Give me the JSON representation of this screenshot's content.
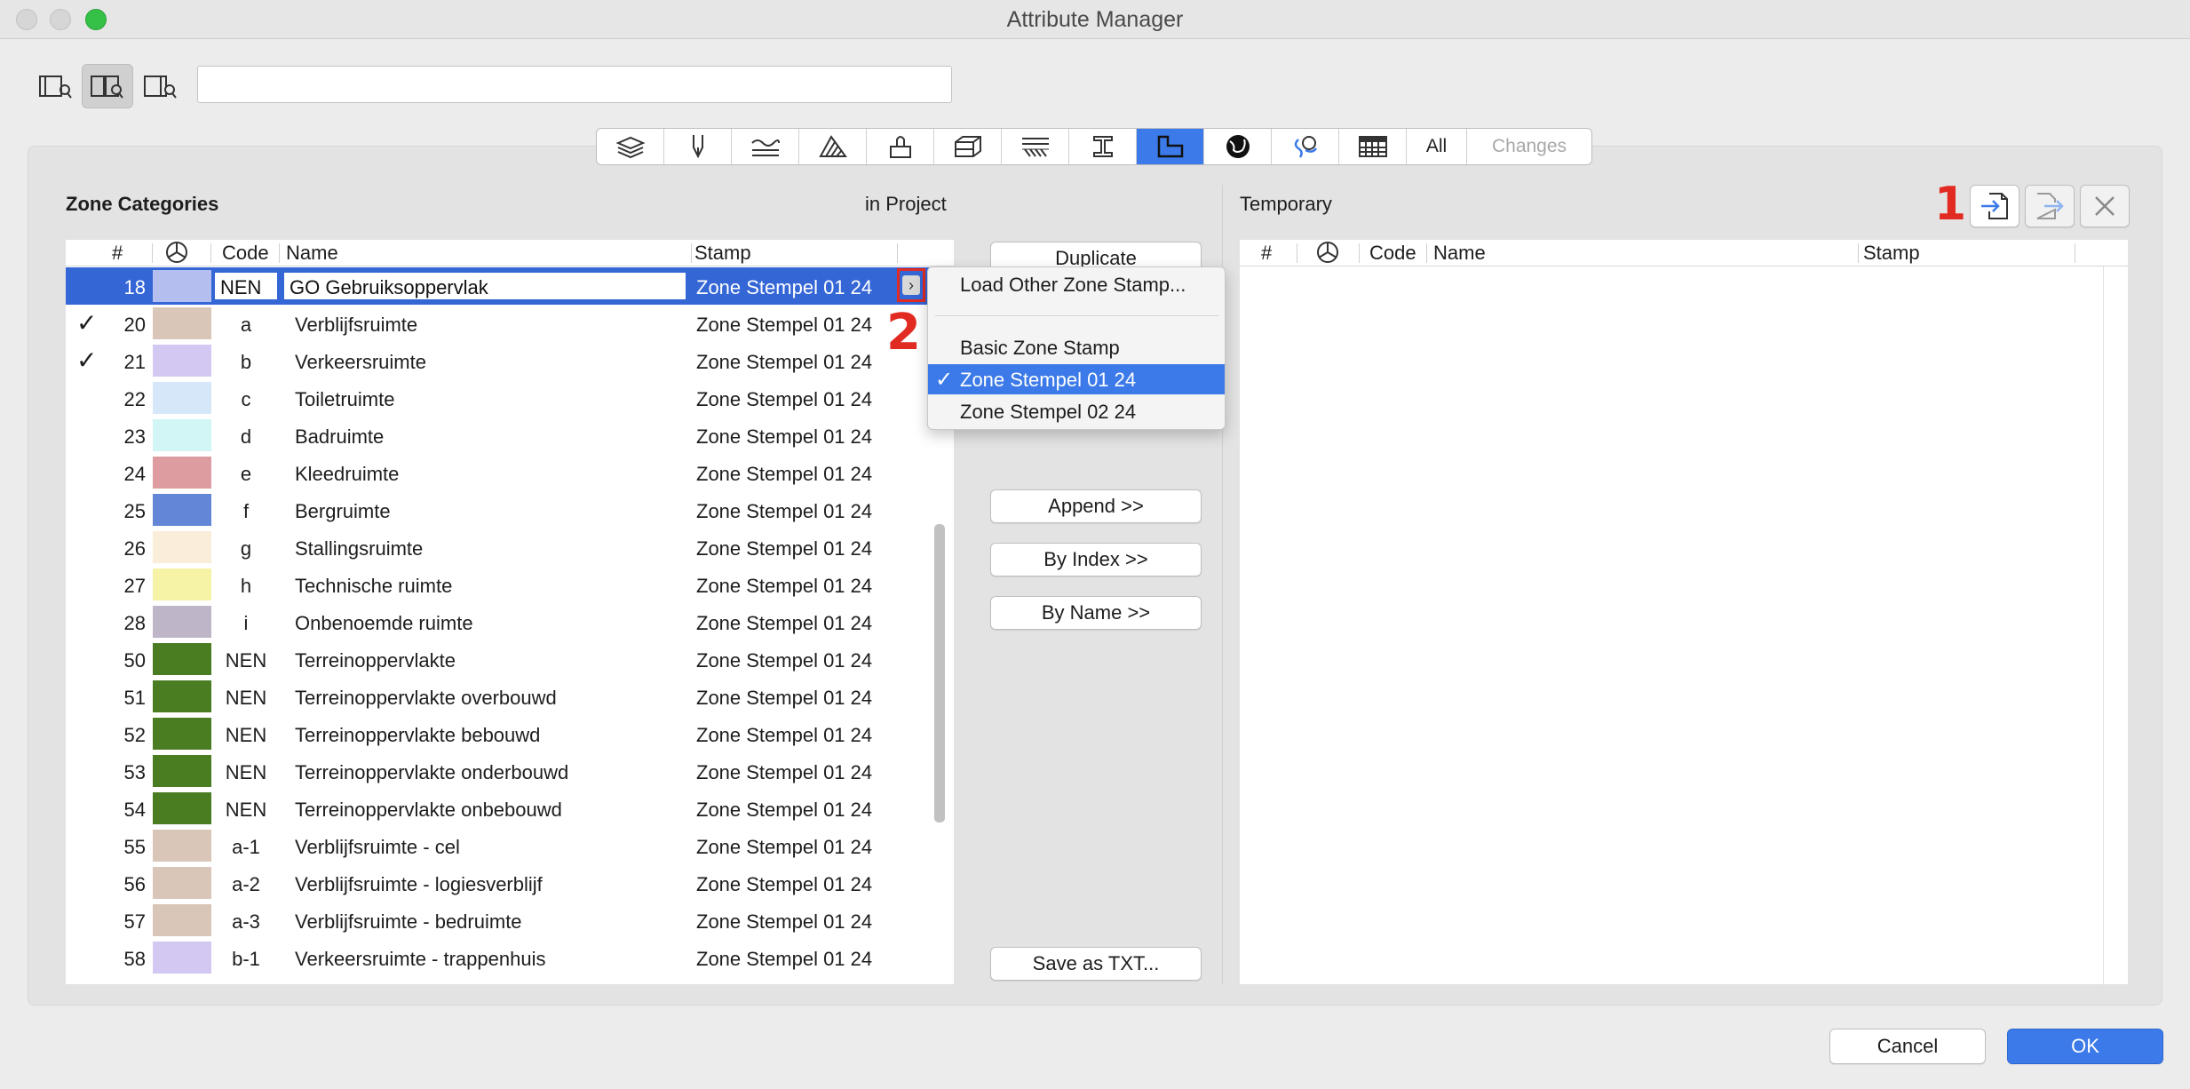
{
  "window": {
    "title": "Attribute Manager"
  },
  "toolbar": {
    "search_value": "",
    "view_icons": [
      "list-view-icon",
      "split-view-icon",
      "single-view-icon"
    ]
  },
  "tabs": {
    "icons": [
      "layers-icon",
      "pen-icon",
      "line-type-icon",
      "fill-icon",
      "surface-icon",
      "building-material-icon",
      "composite-icon",
      "profile-icon",
      "zone-category-icon",
      "mep-system-icon",
      "markup-icon",
      "property-icon"
    ],
    "all_label": "All",
    "changes_label": "Changes"
  },
  "left": {
    "title": "Zone Categories",
    "location": "in Project",
    "columns": {
      "num": "#",
      "code": "Code",
      "name": "Name",
      "stamp": "Stamp"
    },
    "rows": [
      {
        "num": "18",
        "code": "NEN",
        "name": "GO Gebruiksoppervlak",
        "stamp": "Zone Stempel 01 24",
        "color": "#b4bff0",
        "checked": ""
      },
      {
        "num": "20",
        "code": "a",
        "name": "Verblijfsruimte",
        "stamp": "Zone Stempel 01 24",
        "color": "#d9c6b8",
        "checked": "✓"
      },
      {
        "num": "21",
        "code": "b",
        "name": "Verkeersruimte",
        "stamp": "Zone Stempel 01 24",
        "color": "#d3c8f2",
        "checked": "✓"
      },
      {
        "num": "22",
        "code": "c",
        "name": "Toiletruimte",
        "stamp": "Zone Stempel 01 24",
        "color": "#d6e7fa",
        "checked": ""
      },
      {
        "num": "23",
        "code": "d",
        "name": "Badruimte",
        "stamp": "Zone Stempel 01 24",
        "color": "#d2f6f6",
        "checked": ""
      },
      {
        "num": "24",
        "code": "e",
        "name": "Kleedruimte",
        "stamp": "Zone Stempel 01 24",
        "color": "#dc9ca0",
        "checked": ""
      },
      {
        "num": "25",
        "code": "f",
        "name": "Bergruimte",
        "stamp": "Zone Stempel 01 24",
        "color": "#6486d6",
        "checked": ""
      },
      {
        "num": "26",
        "code": "g",
        "name": "Stallingsruimte",
        "stamp": "Zone Stempel 01 24",
        "color": "#faeedb",
        "checked": ""
      },
      {
        "num": "27",
        "code": "h",
        "name": "Technische ruimte",
        "stamp": "Zone Stempel 01 24",
        "color": "#f6f2a6",
        "checked": ""
      },
      {
        "num": "28",
        "code": "i",
        "name": "Onbenoemde ruimte",
        "stamp": "Zone Stempel 01 24",
        "color": "#beb6c8",
        "checked": ""
      },
      {
        "num": "50",
        "code": "NEN",
        "name": "Terreinoppervlakte",
        "stamp": "Zone Stempel 01 24",
        "color": "#4a7c22",
        "checked": ""
      },
      {
        "num": "51",
        "code": "NEN",
        "name": "Terreinoppervlakte overbouwd",
        "stamp": "Zone Stempel 01 24",
        "color": "#4a7c22",
        "checked": ""
      },
      {
        "num": "52",
        "code": "NEN",
        "name": "Terreinoppervlakte bebouwd",
        "stamp": "Zone Stempel 01 24",
        "color": "#4a7c22",
        "checked": ""
      },
      {
        "num": "53",
        "code": "NEN",
        "name": "Terreinoppervlakte onderbouwd",
        "stamp": "Zone Stempel 01 24",
        "color": "#4a7c22",
        "checked": ""
      },
      {
        "num": "54",
        "code": "NEN",
        "name": "Terreinoppervlakte onbebouwd",
        "stamp": "Zone Stempel 01 24",
        "color": "#4a7c22",
        "checked": ""
      },
      {
        "num": "55",
        "code": "a-1",
        "name": "Verblijfsruimte - cel",
        "stamp": "Zone Stempel 01 24",
        "color": "#d9c6b8",
        "checked": ""
      },
      {
        "num": "56",
        "code": "a-2",
        "name": "Verblijfsruimte - logiesverblijf",
        "stamp": "Zone Stempel 01 24",
        "color": "#d9c6b8",
        "checked": ""
      },
      {
        "num": "57",
        "code": "a-3",
        "name": "Verblijfsruimte - bedruimte",
        "stamp": "Zone Stempel 01 24",
        "color": "#d9c6b8",
        "checked": ""
      },
      {
        "num": "58",
        "code": "b-1",
        "name": "Verkeersruimte - trappenhuis",
        "stamp": "Zone Stempel 01 24",
        "color": "#d3c8f2",
        "checked": ""
      }
    ]
  },
  "middle": {
    "duplicate": "Duplicate",
    "append": "Append >>",
    "by_index": "By Index >>",
    "by_name": "By Name >>",
    "save_txt": "Save as TXT..."
  },
  "dropdown": {
    "items": [
      {
        "label": "Load Other Zone Stamp...",
        "checked": ""
      },
      {
        "label": "Basic Zone Stamp",
        "checked": ""
      },
      {
        "label": "Zone Stempel 01 24",
        "checked": "✓"
      },
      {
        "label": "Zone Stempel 02 24",
        "checked": ""
      }
    ]
  },
  "right": {
    "title": "Temporary",
    "columns": {
      "num": "#",
      "code": "Code",
      "name": "Name",
      "stamp": "Stamp"
    }
  },
  "annotations": {
    "one": "1",
    "two": "2"
  },
  "footer": {
    "cancel": "Cancel",
    "ok": "OK"
  },
  "colors": {
    "accent": "#3b7ae8",
    "selection": "#3466d6",
    "annotation": "#e12b22"
  }
}
